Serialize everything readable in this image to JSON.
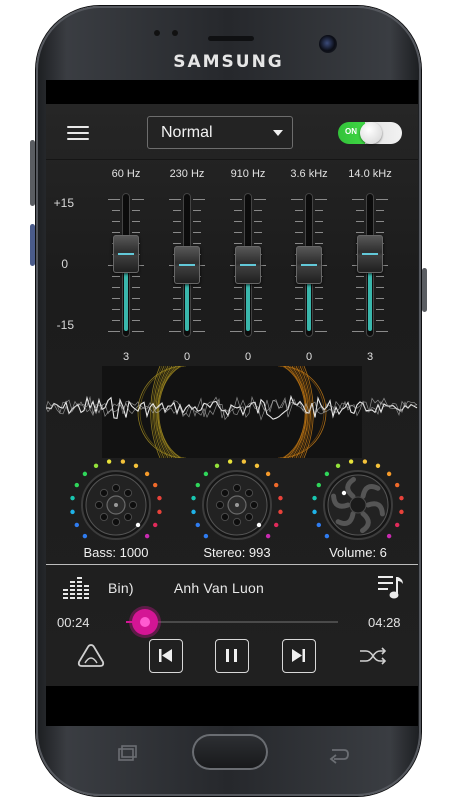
{
  "device": {
    "brand": "SAMSUNG"
  },
  "header": {
    "preset": "Normal",
    "power_toggle": {
      "label": "ON",
      "enabled": true
    }
  },
  "equalizer": {
    "db_scale": [
      "+15",
      "0",
      "-15"
    ],
    "bands": [
      {
        "freq": "60 Hz",
        "value": "3",
        "level": 3
      },
      {
        "freq": "230 Hz",
        "value": "0",
        "level": 0
      },
      {
        "freq": "910 Hz",
        "value": "0",
        "level": 0
      },
      {
        "freq": "3.6 kHz",
        "value": "0",
        "level": 0
      },
      {
        "freq": "14.0 kHz",
        "value": "3",
        "level": 3
      }
    ]
  },
  "knobs": {
    "bass": {
      "label": "Bass: 1000"
    },
    "stereo": {
      "label": "Stereo: 993"
    },
    "volume": {
      "label": "Volume: 6"
    }
  },
  "player": {
    "title": "Bin)          Anh Van Luon",
    "elapsed": "00:24",
    "duration": "04:28",
    "progress": 0.09
  },
  "colors": {
    "accent_teal": "#3ab7ac",
    "seek_accent": "#d41595",
    "toggle_on": "#3fd744",
    "background": "#1e1e1e"
  },
  "icons": {
    "menu": "hamburger-icon",
    "eq": "equalizer-bars-icon",
    "playlist": "playlist-music-icon",
    "left": "triangle-logo-icon",
    "prev": "skip-previous-icon",
    "pause": "pause-icon",
    "next": "skip-next-icon",
    "shuffle": "shuffle-icon"
  }
}
